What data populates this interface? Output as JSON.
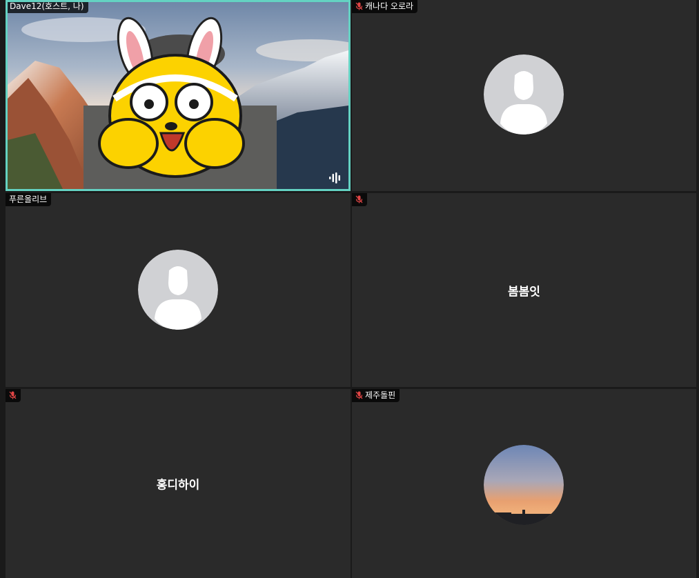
{
  "participants": [
    {
      "name": "Dave12(호스트, 나)",
      "muted": false,
      "video": true,
      "active_speaker": true,
      "overlay": "rabbit-character"
    },
    {
      "name": "캐나다 오로라",
      "muted": true,
      "video": false,
      "avatar": "default-silhouette"
    },
    {
      "name": "푸른올리브",
      "muted": false,
      "video": false,
      "avatar": "default-silhouette"
    },
    {
      "name": "",
      "display_name": "봄봄잇",
      "muted": true,
      "video": false,
      "avatar": "none"
    },
    {
      "name": "",
      "display_name": "홍디하이",
      "muted": true,
      "video": false,
      "avatar": "none"
    },
    {
      "name": "제주돌핀",
      "muted": true,
      "video": false,
      "avatar": "sunset-photo"
    }
  ],
  "colors": {
    "active_speaker_border": "#64d2c2",
    "tile_bg": "#2a2a2a",
    "muted_icon": "#e04545"
  },
  "icons": {
    "muted": "mic-off-icon",
    "audio_level": "audio-level-icon"
  }
}
